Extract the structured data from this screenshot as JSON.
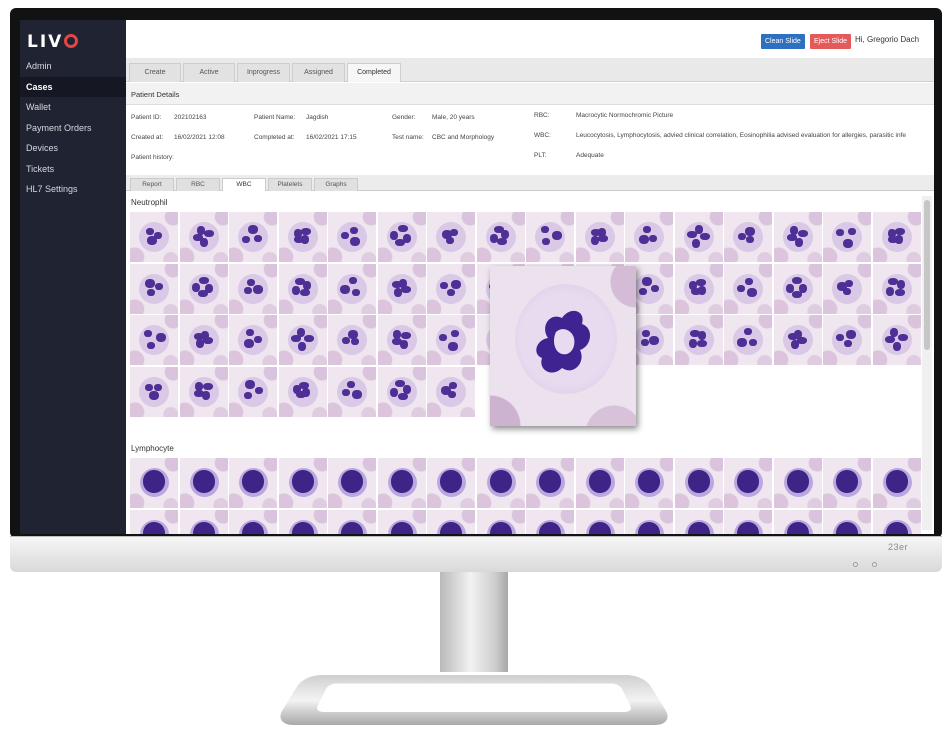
{
  "app": {
    "logo": "LIV",
    "greeting": "Hi, Gregorio Dach",
    "buttons": {
      "clean": "Clean Slide",
      "eject": "Eject Slide"
    },
    "monitor_brand": "23er"
  },
  "sidebar": {
    "items": [
      {
        "label": "Admin",
        "active": false
      },
      {
        "label": "Cases",
        "active": true
      },
      {
        "label": "Wallet",
        "active": false
      },
      {
        "label": "Payment Orders",
        "active": false
      },
      {
        "label": "Devices",
        "active": false
      },
      {
        "label": "Tickets",
        "active": false
      },
      {
        "label": "HL7 Settings",
        "active": false
      }
    ]
  },
  "tabs": [
    {
      "label": "Create",
      "active": false
    },
    {
      "label": "Active",
      "active": false
    },
    {
      "label": "Inprogress",
      "active": false
    },
    {
      "label": "Assigned",
      "active": false
    },
    {
      "label": "Completed",
      "active": true
    }
  ],
  "patient": {
    "section_title": "Patient Details",
    "id_label": "Patient ID:",
    "id_value": "202102163",
    "name_label": "Patient Name:",
    "name_value": "Jagdish",
    "gender_label": "Gender:",
    "gender_value": "Male, 20 years",
    "created_label": "Created at:",
    "created_value": "16/02/2021 12:08",
    "completed_label": "Completed at:",
    "completed_value": "16/02/2021 17:15",
    "test_label": "Test name:",
    "test_value": "CBC and Morphology",
    "history_label": "Patient history:",
    "rbc_label": "RBC:",
    "rbc_value": "Macrocytic Normochromic Picture",
    "wbc_label": "WBC:",
    "wbc_value": "Leucocytosis, Lymphocytosis, advied clinical correlation, Eosinophilia advised evaluation for allergies, parasitic infe",
    "plt_label": "PLT:",
    "plt_value": "Adequate"
  },
  "subtabs": [
    {
      "label": "Report",
      "active": false
    },
    {
      "label": "RBC",
      "active": false
    },
    {
      "label": "WBC",
      "active": true
    },
    {
      "label": "Platelets",
      "active": false
    },
    {
      "label": "Graphs",
      "active": false
    }
  ],
  "wbc": {
    "neutrophil_label": "Neutrophil",
    "lymphocyte_label": "Lymphocyte"
  }
}
